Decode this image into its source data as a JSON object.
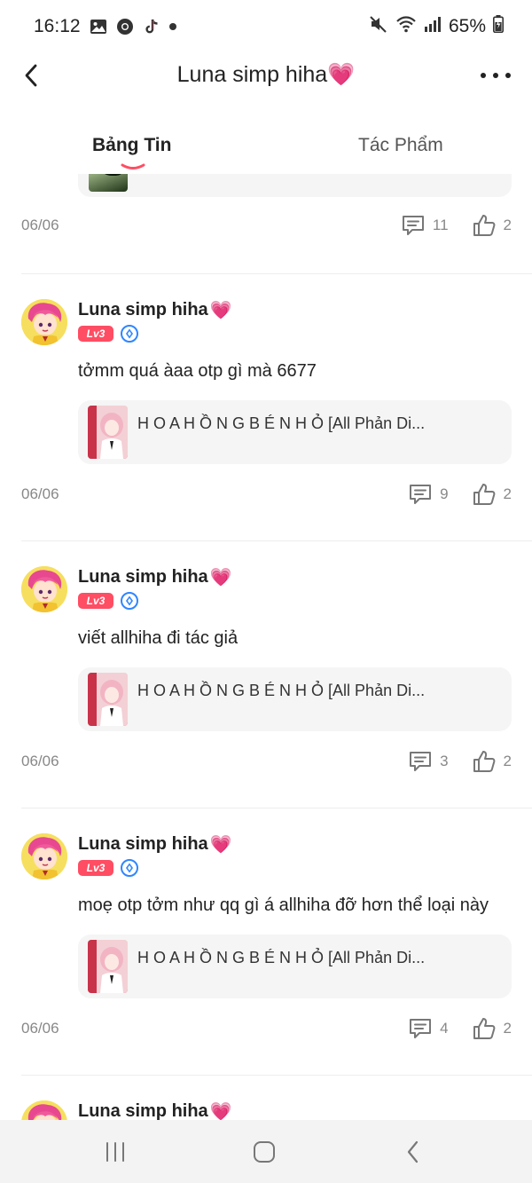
{
  "status_bar": {
    "time": "16:12",
    "battery": "65%",
    "left_icons": [
      "gallery-icon",
      "chrome-icon",
      "tiktok-icon",
      "dot-icon"
    ],
    "right_icons": [
      "mute-icon",
      "wifi-icon",
      "signal-icon",
      "battery-icon"
    ]
  },
  "header": {
    "title": "Luna simp hiha",
    "title_emoji": "💗"
  },
  "tabs": [
    {
      "label": "Bảng Tin",
      "active": true
    },
    {
      "label": "Tác Phẩm",
      "active": false
    }
  ],
  "partial_post": {
    "date": "06/06",
    "comments": "11",
    "likes": "2"
  },
  "posts": [
    {
      "username": "Luna simp hiha",
      "emoji": "💗",
      "level": "Lv3",
      "text": "tởmm quá àaa otp gì mà 6677",
      "ref_title": "H O A H Ồ N G B É N H Ỏ [All Phản Di...",
      "date": "06/06",
      "comments": "9",
      "likes": "2"
    },
    {
      "username": "Luna simp hiha",
      "emoji": "💗",
      "level": "Lv3",
      "text": "viết allhiha đi tác giả",
      "ref_title": "H O A H Ồ N G B É N H Ỏ [All Phản Di...",
      "date": "06/06",
      "comments": "3",
      "likes": "2"
    },
    {
      "username": "Luna simp hiha",
      "emoji": "💗",
      "level": "Lv3",
      "text": "moẹ otp tởm như qq gì á allhiha đỡ hơn thể loại này",
      "ref_title": "H O A H Ồ N G B É N H Ỏ [All Phản Di...",
      "date": "06/06",
      "comments": "4",
      "likes": "2"
    }
  ],
  "partial_bottom_post": {
    "username": "Luna simp hiha",
    "emoji": "💗"
  },
  "colors": {
    "accent": "#ff4d63",
    "badge_blue": "#2f86ff",
    "muted_text": "#888888",
    "card_bg": "#f5f5f5"
  },
  "nav_bar": {
    "buttons": [
      "recent-apps",
      "home",
      "back"
    ]
  }
}
